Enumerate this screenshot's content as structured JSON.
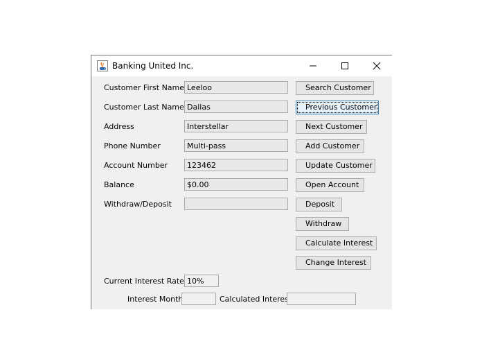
{
  "window": {
    "title": "Banking United Inc."
  },
  "form": {
    "first_name_label": "Customer First Name",
    "first_name_value": "Leeloo",
    "last_name_label": "Customer Last Name",
    "last_name_value": "Dallas",
    "address_label": "Address",
    "address_value": "Interstellar",
    "phone_label": "Phone Number",
    "phone_value": "Multi-pass",
    "account_label": "Account Number",
    "account_value": "123462",
    "balance_label": "Balance",
    "balance_value": "$0.00",
    "withdraw_deposit_label": "Withdraw/Deposit",
    "withdraw_deposit_value": "",
    "interest_rate_label": "Current Interest Rate",
    "interest_rate_value": "10%",
    "interest_month_label": "Interest Month",
    "interest_month_value": "",
    "calculated_interest_label": "Calculated Interest",
    "calculated_interest_value": ""
  },
  "buttons": {
    "search": "Search Customer",
    "previous": "Previous Customer",
    "next": "Next Customer",
    "add": "Add Customer",
    "update": "Update Customer",
    "open_account": "Open Account",
    "deposit": "Deposit",
    "withdraw": "Withdraw",
    "calculate_interest": "Calculate Interest",
    "change_interest": "Change Interest"
  },
  "icons": {
    "app": "java-cup-icon",
    "minimize": "minimize-icon",
    "maximize": "maximize-icon",
    "close": "close-icon"
  }
}
